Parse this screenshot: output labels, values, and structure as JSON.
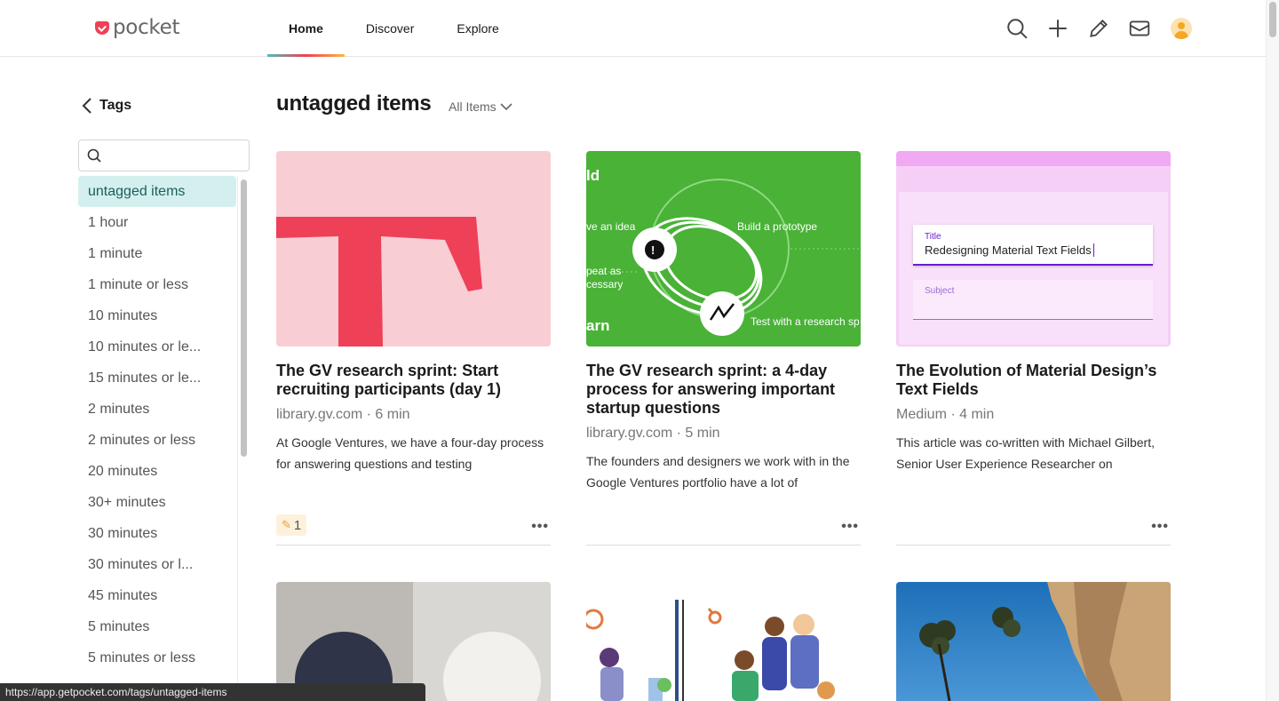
{
  "app": {
    "logo_text": "pocket"
  },
  "nav": {
    "tabs": [
      "Home",
      "Discover",
      "Explore"
    ]
  },
  "header_icons": [
    "search-icon",
    "add-icon",
    "pencil-icon",
    "mail-icon",
    "avatar"
  ],
  "sidebar": {
    "back_label": "Tags",
    "search_placeholder": "",
    "tags": [
      "untagged items",
      "1 hour",
      "1 minute",
      "1 minute or less",
      "10 minutes",
      "10 minutes or le...",
      "15 minutes or le...",
      "2 minutes",
      "2 minutes or less",
      "20 minutes",
      "30+ minutes",
      "30 minutes",
      "30 minutes or l...",
      "45 minutes",
      "5 minutes",
      "5 minutes or less"
    ]
  },
  "main": {
    "title": "untagged items",
    "filter_label": "All Items",
    "cards": [
      {
        "title": "The GV research sprint: Start recruiting participants (day 1)",
        "meta": "library.gv.com · 6 min",
        "excerpt": "At Google Ventures, we have a four-day process for answering questions and testing",
        "highlights": "1"
      },
      {
        "title": "The GV research sprint: a 4-day process for answering important startup questions",
        "meta": "library.gv.com · 5 min",
        "excerpt": "The founders and designers we work with in the Google Ventures portfolio have a lot of"
      },
      {
        "title": "The Evolution of Material Design’s Text Fields",
        "meta": "Medium · 4 min",
        "excerpt": "This article was co-written with Michael Gilbert, Senior User Experience Researcher on"
      }
    ],
    "thumb_texts": {
      "green": {
        "t1": "ld",
        "t2": "ve an idea",
        "t3": "Build a prototype",
        "t4": "peat as",
        "t5": "cessary",
        "t6": "arn",
        "t7": "Test with a research sp"
      },
      "material": {
        "label1": "Title",
        "value1": "Redesigning Material Text Fields",
        "label2": "Subject"
      }
    }
  },
  "status_bar": {
    "url": "https://app.getpocket.com/tags/untagged-items"
  },
  "colors": {
    "brand": "#ef4056",
    "active_tag_bg": "#d4f0ee",
    "accent_teal": "#50bcb6"
  }
}
